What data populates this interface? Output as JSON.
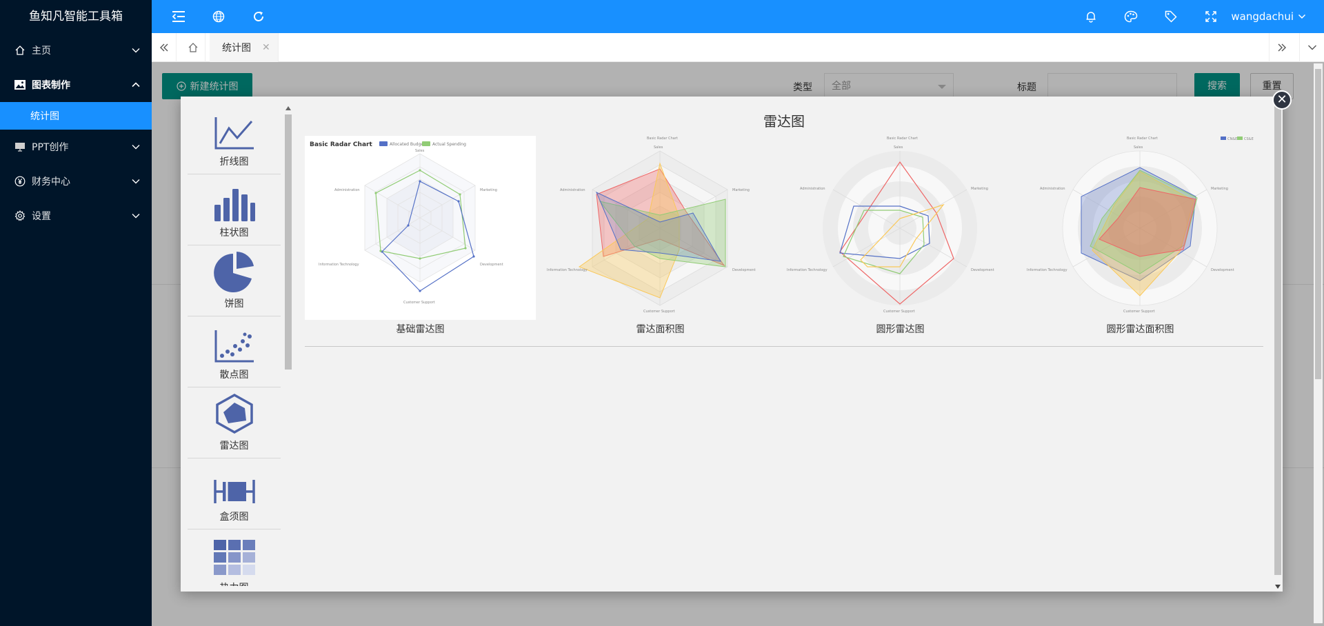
{
  "app": {
    "title": "鱼知凡智能工具箱"
  },
  "sidebar": {
    "items": [
      {
        "label": "主页",
        "icon": "home-icon"
      },
      {
        "label": "图表制作",
        "icon": "image-icon",
        "open": true,
        "children": [
          {
            "label": "统计图",
            "active": true
          }
        ]
      },
      {
        "label": "PPT创作",
        "icon": "presentation-icon"
      },
      {
        "label": "财务中心",
        "icon": "yen-icon"
      },
      {
        "label": "设置",
        "icon": "gear-icon"
      }
    ]
  },
  "header": {
    "username": "wangdachui"
  },
  "tabs": {
    "active": "统计图"
  },
  "filters": {
    "new_button": "新建统计图",
    "type_label": "类型",
    "type_value": "全部",
    "title_label": "标题",
    "search_button": "搜索",
    "reset_button": "重置"
  },
  "modal": {
    "title": "雷达图",
    "chart_types": [
      {
        "label": "折线图",
        "icon": "line-chart-icon"
      },
      {
        "label": "柱状图",
        "icon": "bar-chart-icon"
      },
      {
        "label": "饼图",
        "icon": "pie-chart-icon"
      },
      {
        "label": "散点图",
        "icon": "scatter-chart-icon"
      },
      {
        "label": "雷达图",
        "icon": "radar-chart-icon"
      },
      {
        "label": "盒须图",
        "icon": "boxplot-icon"
      },
      {
        "label": "热力图",
        "icon": "heatmap-icon"
      }
    ],
    "templates": [
      {
        "label": "基础雷达图",
        "preview": {
          "title": "Basic Radar Chart",
          "legend": [
            "Allocated Budget",
            "Actual Spending"
          ],
          "indicators": [
            "Sales",
            "Marketing",
            "Development",
            "Customer Support",
            "Information Technology",
            "Administration"
          ]
        }
      },
      {
        "label": "雷达面积图",
        "preview": {
          "title": "Basic Radar Chart",
          "indicators": [
            "Sales",
            "Marketing",
            "Development",
            "Customer Support",
            "Information Technology",
            "Administration"
          ]
        }
      },
      {
        "label": "圆形雷达图",
        "preview": {
          "title": "Basic Radar Chart",
          "indicators": [
            "Sales",
            "Marketing",
            "Development",
            "Customer Support",
            "Information Technology",
            "Administration"
          ]
        }
      },
      {
        "label": "圆形雷达面积图",
        "preview": {
          "title": "Basic Radar Chart",
          "legend": [
            "CN&E",
            "CS&E"
          ],
          "indicators": [
            "Sales",
            "Marketing",
            "Development",
            "Customer Support",
            "Information Technology",
            "Administration"
          ]
        }
      }
    ]
  },
  "colors": {
    "sidebar_bg": "#001529",
    "primary": "#1890ff",
    "teal_button": "#009688",
    "series_blue": "#5470c6",
    "series_green": "#91cc75",
    "series_yellow": "#fac858",
    "series_red": "#ee6666"
  }
}
